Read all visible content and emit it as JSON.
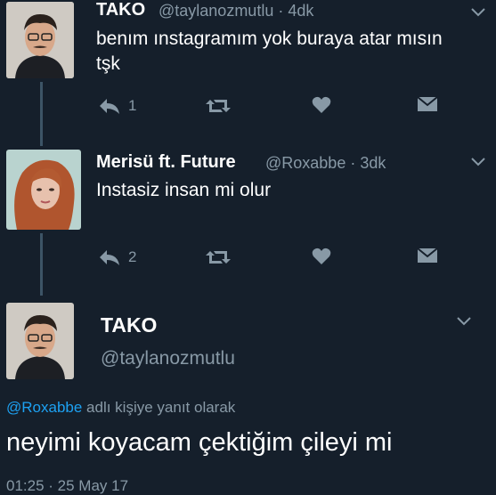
{
  "tweets": [
    {
      "name": "TAKO",
      "handle": "@taylanozmutlu · 4dk",
      "text_line1": "benım ınstagramım yok buraya atar mısın",
      "text_line2": "tşk",
      "reply_count": "1",
      "avatar_icon": "person-avatar-icon"
    },
    {
      "name": "Merisü ft. Future",
      "handle": "@Roxabbe · 3dk",
      "text_line1": "Instasiz insan mi olur",
      "reply_count": "2",
      "avatar_icon": "person-avatar-icon"
    }
  ],
  "main_tweet": {
    "name": "TAKO",
    "handle": "@taylanozmutlu",
    "reply_mention": "@Roxabbe",
    "reply_suffix": "adlı kişiye yanıt olarak",
    "text": "neyimi koyacam çektiğim çileyi mi",
    "timestamp": "01:25 · 25 May 17"
  },
  "colors": {
    "background": "#151f2b",
    "secondary_text": "#8899a6",
    "link": "#1da1f2"
  }
}
